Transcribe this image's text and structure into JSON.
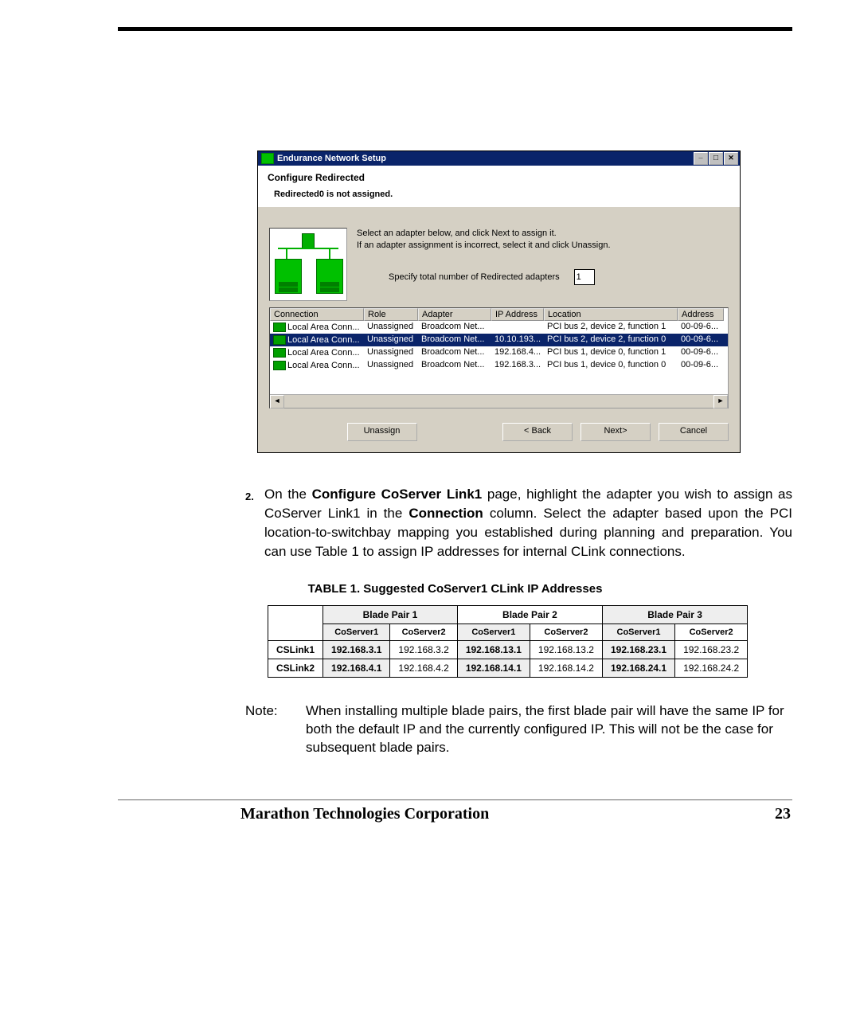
{
  "dialog": {
    "window_title": "Endurance Network Setup",
    "header_title": "Configure Redirected",
    "header_sub": "Redirected0 is not assigned.",
    "instructions_line1": "Select an adapter below, and click Next to assign it.",
    "instructions_line2": "If an adapter assignment is incorrect, select it and click Unassign.",
    "redir_label": "Specify total number of Redirected adapters",
    "redir_value": "1",
    "columns": {
      "connection": "Connection",
      "role": "Role",
      "adapter": "Adapter",
      "ip": "IP Address",
      "location": "Location",
      "address": "Address"
    },
    "rows": [
      {
        "conn": "Local Area Conn...",
        "role": "Unassigned",
        "adapter": "Broadcom Net...",
        "ip": "",
        "loc": "PCI bus 2, device 2, function 1",
        "addr": "00-09-6..."
      },
      {
        "conn": "Local Area Conn...",
        "role": "Unassigned",
        "adapter": "Broadcom Net...",
        "ip": "10.10.193...",
        "loc": "PCI bus 2, device 2, function 0",
        "addr": "00-09-6...",
        "selected": true
      },
      {
        "conn": "Local Area Conn...",
        "role": "Unassigned",
        "adapter": "Broadcom Net...",
        "ip": "192.168.4...",
        "loc": "PCI bus 1, device 0, function 1",
        "addr": "00-09-6..."
      },
      {
        "conn": "Local Area Conn...",
        "role": "Unassigned",
        "adapter": "Broadcom Net...",
        "ip": "192.168.3...",
        "loc": "PCI bus 1, device 0, function 0",
        "addr": "00-09-6..."
      }
    ],
    "buttons": {
      "unassign": "Unassign",
      "back": "< Back",
      "next": "Next>",
      "cancel": "Cancel"
    }
  },
  "step": {
    "num": "2.",
    "pre": "On the ",
    "bold1": "Configure CoServer Link1",
    "mid1": " page, highlight the adapter you wish to assign as CoServer Link1 in the ",
    "bold2": "Connection",
    "mid2": " column. Select the adapter based upon the PCI location-to-switchbay mapping you established during planning and preparation. You can use Table 1 to assign IP addresses for internal CLink connections."
  },
  "table": {
    "title": "TABLE 1. Suggested  CoServer1 CLink IP Addresses",
    "groups": [
      "Blade Pair 1",
      "Blade Pair 2",
      "Blade Pair 3"
    ],
    "subs": [
      "CoServer1",
      "CoServer2",
      "CoServer1",
      "CoServer2",
      "CoServer1",
      "CoServer2"
    ],
    "rows": [
      {
        "label": "CSLink1",
        "cells": [
          "192.168.3.1",
          "192.168.3.2",
          "192.168.13.1",
          "192.168.13.2",
          "192.168.23.1",
          "192.168.23.2"
        ]
      },
      {
        "label": "CSLink2",
        "cells": [
          "192.168.4.1",
          "192.168.4.2",
          "192.168.14.1",
          "192.168.14.2",
          "192.168.24.1",
          "192.168.24.2"
        ]
      }
    ]
  },
  "note": {
    "label": "Note:",
    "text": "When installing multiple blade pairs, the first blade pair will have the same IP for both the default IP and the currently configured IP. This will not be the case for subsequent blade pairs."
  },
  "footer": {
    "company": "Marathon Technologies Corporation",
    "page": "23"
  }
}
